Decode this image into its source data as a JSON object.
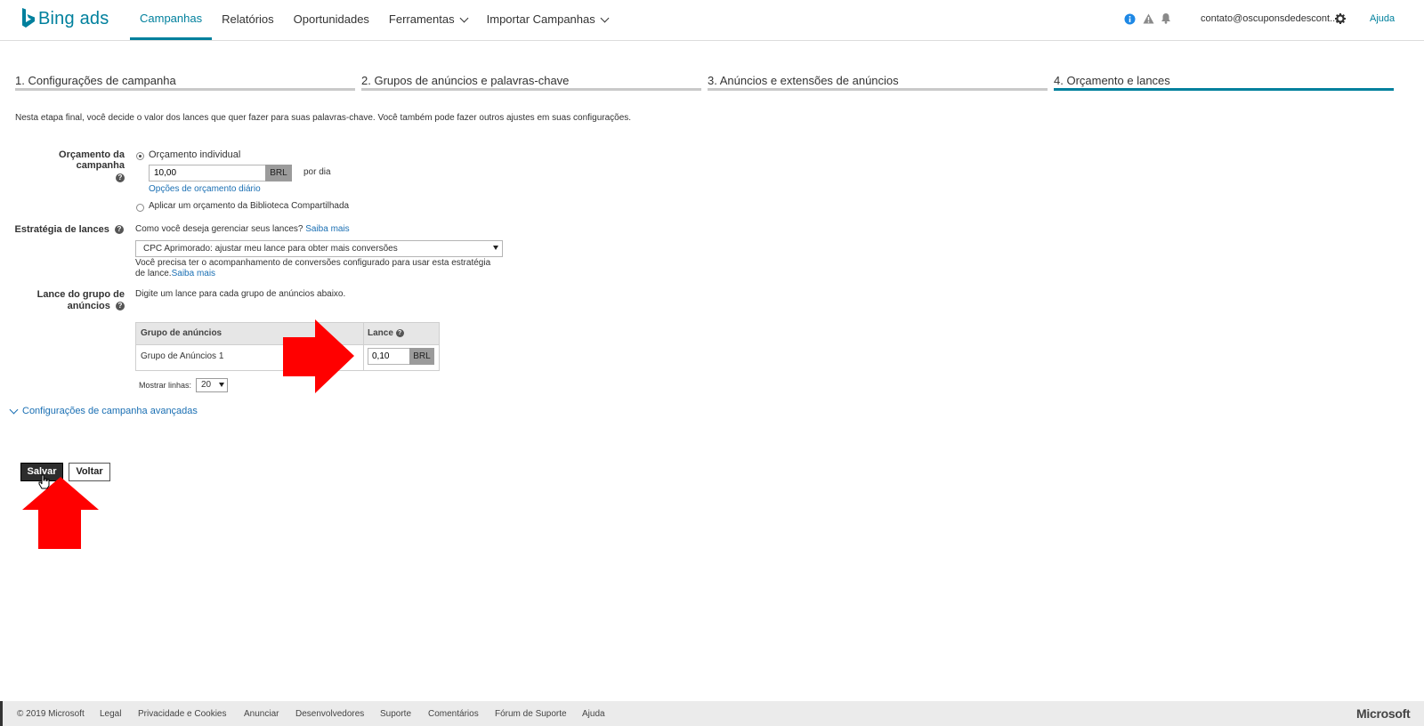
{
  "brand": {
    "name": "Bing ads"
  },
  "nav": {
    "items": [
      {
        "label": "Campanhas",
        "active": true
      },
      {
        "label": "Relatórios"
      },
      {
        "label": "Oportunidades"
      },
      {
        "label": "Ferramentas",
        "dropdown": true
      },
      {
        "label": "Importar Campanhas",
        "dropdown": true
      }
    ],
    "account": "contato@oscuponsdedescont...",
    "help_link": "Ajuda"
  },
  "steps": [
    {
      "label": "1. Configurações de campanha"
    },
    {
      "label": "2. Grupos de anúncios e palavras-chave"
    },
    {
      "label": "3. Anúncios e extensões de anúncios"
    },
    {
      "label": "4. Orçamento e lances",
      "active": true
    }
  ],
  "intro": "Nesta etapa final, você decide o valor dos lances que quer fazer para suas palavras-chave. Você também pode fazer outros ajustes em suas configurações.",
  "budget": {
    "label": "Orçamento da campanha",
    "option_individual": "Orçamento individual",
    "value": "10,00",
    "currency": "BRL",
    "per_day": "por dia",
    "daily_options_link": "Opções de orçamento diário",
    "option_shared": "Aplicar um orçamento da Biblioteca Compartilhada"
  },
  "bidding": {
    "label": "Estratégia de lances",
    "question": "Como você deseja gerenciar seus lances?",
    "learn_more": "Saiba mais",
    "selected": "CPC Aprimorado: ajustar meu lance para obter mais conversões",
    "note_line1": "Você precisa ter o acompanhamento de conversões configurado para usar esta estratégia",
    "note_line2": "de lance.",
    "note_link": "Saiba mais"
  },
  "adgroup_bid": {
    "label_line1": "Lance do grupo de",
    "label_line2": "anúncios",
    "instruction": "Digite um lance para cada grupo de anúncios abaixo.",
    "columns": [
      "Grupo de anúncios",
      "Lance"
    ],
    "rows": [
      {
        "name": "Grupo de Anúncios 1",
        "bid": "0,10",
        "currency": "BRL"
      }
    ],
    "show_rows_label": "Mostrar linhas:",
    "show_rows_value": "20"
  },
  "advanced_link": "Configurações de campanha avançadas",
  "buttons": {
    "save": "Salvar",
    "back": "Voltar"
  },
  "footer": {
    "links": [
      "© 2019 Microsoft",
      "Legal",
      "Privacidade e Cookies",
      "Anunciar",
      "Desenvolvedores",
      "Suporte",
      "Comentários",
      "Fórum de Suporte",
      "Ajuda"
    ],
    "brand": "Microsoft"
  },
  "colors": {
    "accent": "#00809d",
    "link": "#1a6fb3",
    "annotation_arrow": "#ff0000",
    "info_icon": "#1e88e5"
  }
}
